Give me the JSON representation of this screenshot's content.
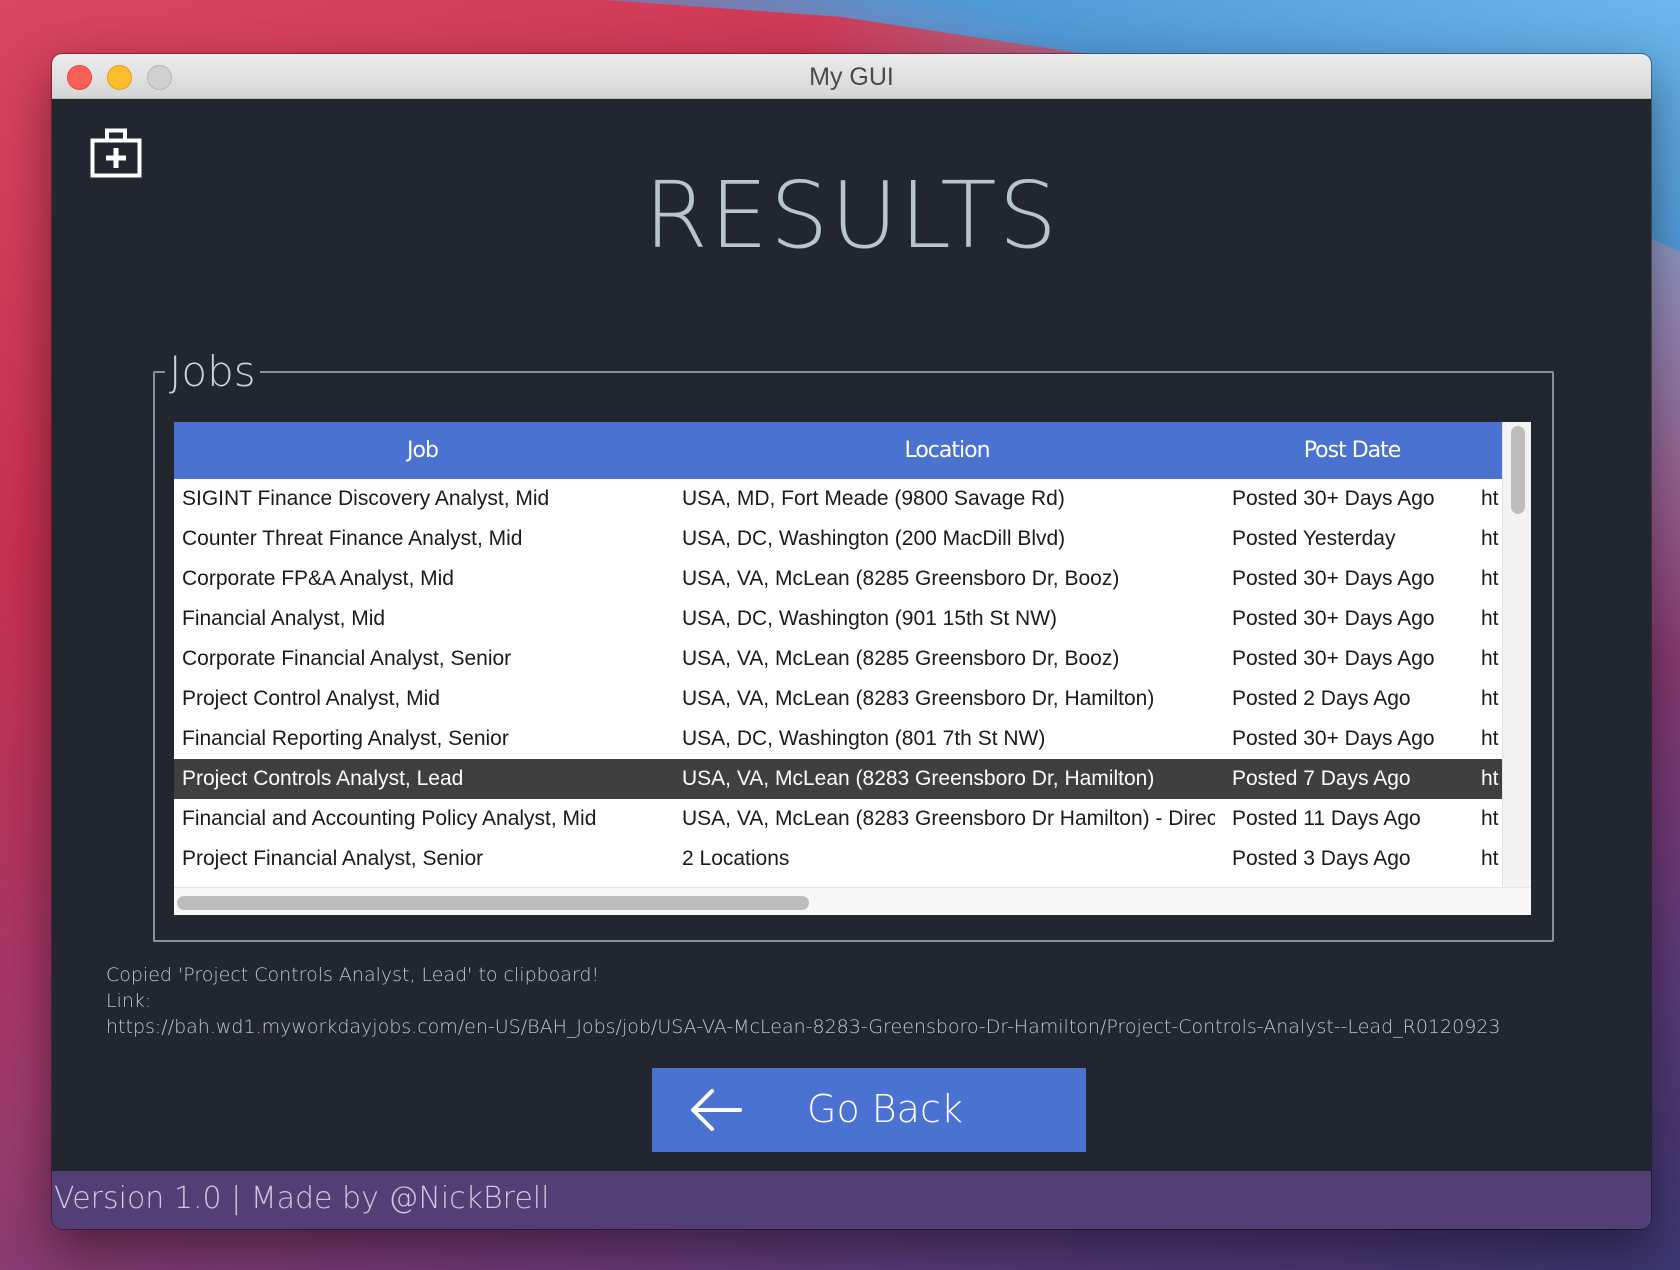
{
  "window": {
    "title": "My GUI"
  },
  "header": {
    "heading": "RESULTS"
  },
  "jobs_section": {
    "legend": "Jobs",
    "columns": [
      "Job",
      "Location",
      "Post Date"
    ],
    "rows": [
      {
        "job": "SIGINT Finance Discovery Analyst, Mid",
        "location": "USA, MD, Fort Meade (9800 Savage Rd)",
        "post_date": "Posted 30+ Days Ago",
        "link": "ht"
      },
      {
        "job": "Counter Threat Finance Analyst, Mid",
        "location": "USA, DC, Washington (200 MacDill Blvd)",
        "post_date": "Posted Yesterday",
        "link": "ht"
      },
      {
        "job": "Corporate FP&A Analyst, Mid",
        "location": "USA, VA, McLean (8285 Greensboro Dr, Booz)",
        "post_date": "Posted 30+ Days Ago",
        "link": "ht"
      },
      {
        "job": "Financial Analyst, Mid",
        "location": "USA, DC, Washington (901 15th St NW)",
        "post_date": "Posted 30+ Days Ago",
        "link": "ht"
      },
      {
        "job": "Corporate Financial Analyst, Senior",
        "location": "USA, VA, McLean (8285 Greensboro Dr, Booz)",
        "post_date": "Posted 30+ Days Ago",
        "link": "ht"
      },
      {
        "job": "Project Control Analyst, Mid",
        "location": "USA, VA, McLean (8283 Greensboro Dr, Hamilton)",
        "post_date": "Posted 2 Days Ago",
        "link": "ht"
      },
      {
        "job": "Financial Reporting Analyst, Senior",
        "location": "USA, DC, Washington (801 7th St NW)",
        "post_date": "Posted 30+ Days Ago",
        "link": "ht"
      },
      {
        "job": "Project Controls Analyst, Lead",
        "location": "USA, VA, McLean (8283 Greensboro Dr, Hamilton)",
        "post_date": "Posted 7 Days Ago",
        "link": "ht",
        "selected": true
      },
      {
        "job": "Financial and Accounting Policy Analyst, Mid",
        "location": "USA, VA, McLean (8283 Greensboro Dr Hamilton) - Direc",
        "post_date": "Posted 11 Days Ago",
        "link": "ht"
      },
      {
        "job": "Project Financial Analyst, Senior",
        "location": "2 Locations",
        "post_date": "Posted 3 Days Ago",
        "link": "ht"
      }
    ]
  },
  "status": {
    "line1": "Copied 'Project Controls Analyst, Lead' to clipboard!",
    "line2": "Link:",
    "line3": "https://bah.wd1.myworkdayjobs.com/en-US/BAH_Jobs/job/USA-VA-McLean-8283-Greensboro-Dr-Hamilton/Project-Controls-Analyst--Lead_R0120923"
  },
  "buttons": {
    "go_back": "Go Back"
  },
  "footer": {
    "text": "Version 1.0 | Made by @NickBrell"
  },
  "icons": {
    "app": "medical-kit-icon",
    "back": "arrow-left-icon"
  },
  "colors": {
    "accent": "#4a72d0",
    "background": "#22262e",
    "footer": "#533f76",
    "selected_row": "#3f3f3f"
  }
}
